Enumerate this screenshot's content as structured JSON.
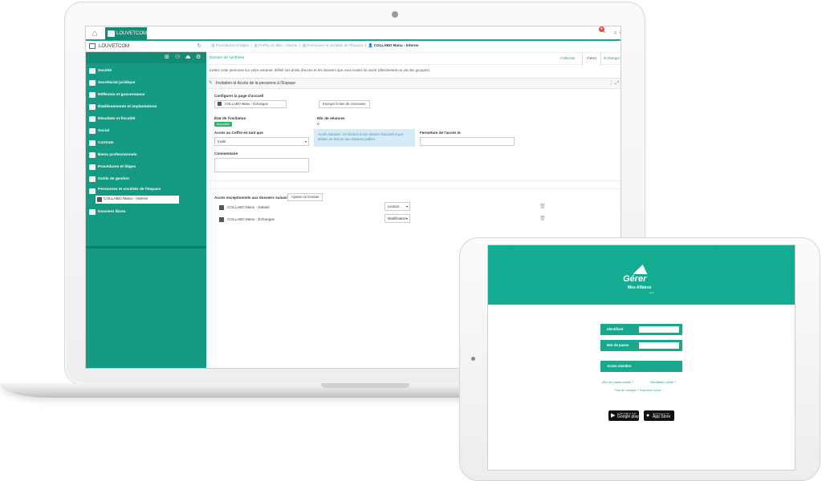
{
  "laptop": {
    "app": {
      "tab_label": "LOUVETCOM"
    },
    "sidebar": {
      "title": "LOUVETCOM",
      "items": [
        {
          "label": "Société"
        },
        {
          "label": "Secrétariat juridique"
        },
        {
          "label": "Réflexion et gouvernance"
        },
        {
          "label": "Établissements et implantations"
        },
        {
          "label": "Résultats et fiscalité"
        },
        {
          "label": "Social"
        },
        {
          "label": "Contrats"
        },
        {
          "label": "Biens professionnels"
        },
        {
          "label": "Procédures et litiges"
        },
        {
          "label": "Outils de gestion"
        },
        {
          "label": "Personnes et sociétés de l'Espace"
        },
        {
          "label": "Dossiers libres"
        }
      ],
      "selected_sub": "COLLABO Manu - Interne"
    },
    "breadcrumb": {
      "b1": "Procédures et litiges",
      "b2": "PAPELLE Milo - Interne",
      "b3": "Personnes et sociétés de l'Espace",
      "current": "COLLABO Manu - Interne"
    },
    "subnav": {
      "left_link": "Dossier de synthèse",
      "tabs": [
        "Collecter",
        "Gérer",
        "Échanger"
      ]
    },
    "intro_text": "Invitez cette personne sur votre extranet: définit ses droits d'accès et les dossiers que vous voulez lui ouvrir (directement ou via des groupes).",
    "panel_title": "Invitation et Accès de la personne à l'Espace",
    "form": {
      "home_page_label": "Configurer la page d'accueil",
      "home_page_value": "COLLABO Manu - Échanges",
      "send_link_button": "Envoyer le lien de connexion",
      "status_label": "État de l'invitation",
      "status_value": "Acceptée",
      "reminders_label": "Nbr de relances",
      "reminders_value": "0",
      "vault_label": "Accès au Coffre en tant que",
      "vault_value": "Invité",
      "info_text": "Accès extranet : en écriture à son dossier d'accueil et par défaut, en lecture aux dossiers publics",
      "close_label": "Fermeture de l'accès le",
      "comment_label": "Commentaire"
    },
    "exceptions": {
      "label": "Accès exceptionnels aux dossiers suivants",
      "add_button": "Ajouter un Dossier",
      "rows": [
        {
          "name": "COLLABO Manu - Salarié",
          "access": "Lecture"
        },
        {
          "name": "COLLABO Manu - Échanges",
          "access": "Modification"
        }
      ]
    }
  },
  "tablet": {
    "logo": {
      "line1": "Gérer",
      "line2": "Mes Affaires",
      "line3": ".com"
    },
    "login_label": "Identifiant",
    "password_label": "Mot de passe",
    "submit_label": "Accès membre",
    "forgot_password": "Mot de passe oublié ?",
    "forgot_login": "Identifiant oublié ?",
    "contact_link": "Pas de compte ? Inscrivez-vous...",
    "google_small": "DISPONIBLE SUR",
    "google_big": "Google play",
    "apple_small": "Download on the",
    "apple_big": "App Store"
  },
  "colors": {
    "brand": "#159b83",
    "brand_dark": "#138b75",
    "success": "#2fb56a"
  }
}
